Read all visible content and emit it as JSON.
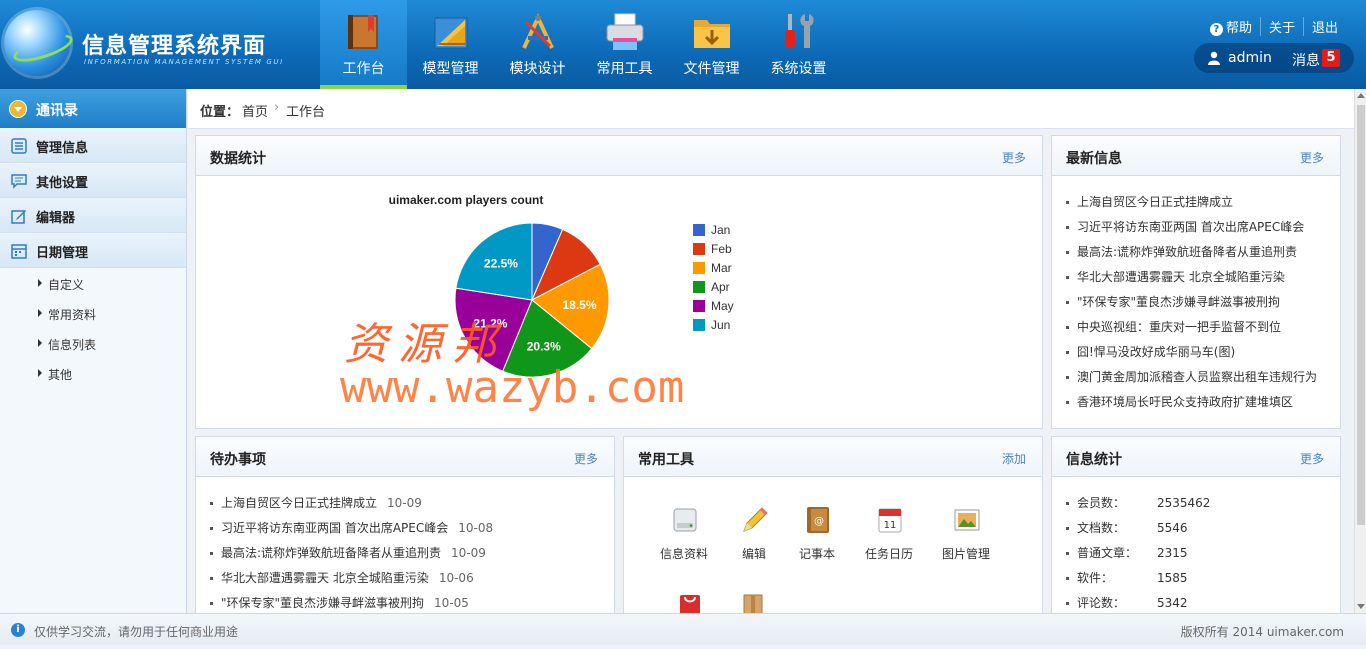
{
  "app": {
    "title": "信息管理系统界面",
    "subtitle": "INFORMATION MANAGEMENT SYSTEM GUI"
  },
  "nav": {
    "items": [
      {
        "label": "工作台",
        "icon": "book-icon",
        "active": true
      },
      {
        "label": "模型管理",
        "icon": "ruler-triangle-icon"
      },
      {
        "label": "模块设计",
        "icon": "design-tools-icon"
      },
      {
        "label": "常用工具",
        "icon": "printer-icon"
      },
      {
        "label": "文件管理",
        "icon": "folder-icon"
      },
      {
        "label": "系统设置",
        "icon": "wrench-screwdriver-icon"
      }
    ]
  },
  "topbar": {
    "help": "帮助",
    "about": "关于",
    "logout": "退出",
    "username": "admin",
    "message_label": "消息",
    "message_count": "5"
  },
  "sidebar": {
    "header": "通讯录",
    "menus": [
      {
        "label": "管理信息",
        "icon": "list-icon"
      },
      {
        "label": "其他设置",
        "icon": "chat-icon"
      },
      {
        "label": "编辑器",
        "icon": "edit-icon"
      },
      {
        "label": "日期管理",
        "icon": "calendar-icon"
      }
    ],
    "subitems": [
      "自定义",
      "常用资料",
      "信息列表",
      "其他"
    ]
  },
  "breadcrumb": {
    "position_label": "位置：",
    "home": "首页",
    "sep": "›",
    "current": "工作台"
  },
  "panels": {
    "stats": {
      "title": "数据统计",
      "more": "更多"
    },
    "news": {
      "title": "最新信息",
      "more": "更多"
    },
    "todo": {
      "title": "待办事项",
      "more": "更多"
    },
    "tools": {
      "title": "常用工具",
      "more": "添加"
    },
    "info": {
      "title": "信息统计",
      "more": "更多"
    }
  },
  "chart_data": {
    "type": "pie",
    "title": "uimaker.com players count",
    "categories": [
      "Jan",
      "Feb",
      "Mar",
      "Apr",
      "May",
      "Jun"
    ],
    "values": [
      6.5,
      10.8,
      18.5,
      20.3,
      21.2,
      22.5
    ],
    "data_labels": {
      "Mar": "18.5%",
      "Apr": "20.3%",
      "May": "21.2%",
      "Jun": "22.5%"
    },
    "colors": [
      "#3366cc",
      "#dc3912",
      "#ff9900",
      "#109618",
      "#990099",
      "#0099c6"
    ],
    "legend": "right"
  },
  "news_items": [
    "上海自贸区今日正式挂牌成立",
    "习近平将访东南亚两国 首次出席APEC峰会",
    "最高法:谎称炸弹致航班备降者从重追刑责",
    "华北大部遭遇雾霾天 北京全城陷重污染",
    "\"环保专家\"董良杰涉嫌寻衅滋事被刑拘",
    "中央巡视组：重庆对一把手监督不到位",
    "囧!悍马没改好成华丽马车(图)",
    "澳门黄金周加派稽查人员监察出租车违规行为",
    "香港环境局长吁民众支持政府扩建堆填区"
  ],
  "todo_items": [
    {
      "text": "上海自贸区今日正式挂牌成立",
      "date": "10-09"
    },
    {
      "text": "习近平将访东南亚两国 首次出席APEC峰会",
      "date": "10-08"
    },
    {
      "text": "最高法:谎称炸弹致航班备降者从重追刑责",
      "date": "10-09"
    },
    {
      "text": "华北大部遭遇雾霾天 北京全城陷重污染",
      "date": "10-06"
    },
    {
      "text": "\"环保专家\"董良杰涉嫌寻衅滋事被刑拘",
      "date": "10-05"
    }
  ],
  "tools": [
    {
      "label": "信息资料",
      "icon": "drive-icon"
    },
    {
      "label": "编辑",
      "icon": "pencil-icon"
    },
    {
      "label": "记事本",
      "icon": "notebook-icon"
    },
    {
      "label": "任务日历",
      "icon": "calendar-icon"
    },
    {
      "label": "图片管理",
      "icon": "picture-icon"
    },
    {
      "label": "",
      "icon": "gift-bag-icon"
    },
    {
      "label": "",
      "icon": "package-icon"
    }
  ],
  "info_stats": [
    {
      "label": "会员数：",
      "value": "2535462"
    },
    {
      "label": "文档数：",
      "value": "5546"
    },
    {
      "label": "普通文章：",
      "value": "2315"
    },
    {
      "label": "软件：",
      "value": "1585"
    },
    {
      "label": "评论数：",
      "value": "5342"
    }
  ],
  "footer": {
    "left": "仅供学习交流，请勿用于任何商业用途",
    "right": "版权所有 2014 uimaker.com"
  },
  "watermark": {
    "line1": "资源邦",
    "line2": "www.wazyb.com"
  }
}
